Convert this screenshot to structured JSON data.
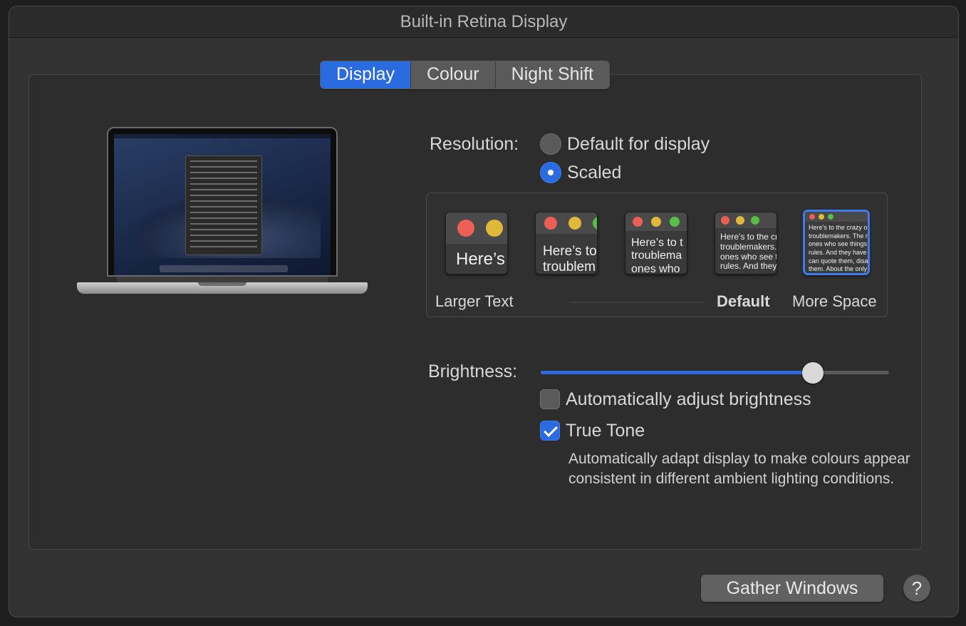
{
  "window": {
    "title": "Built-in Retina Display"
  },
  "tabs": [
    {
      "label": "Display",
      "active": true
    },
    {
      "label": "Colour",
      "active": false
    },
    {
      "label": "Night Shift",
      "active": false
    }
  ],
  "resolution": {
    "label": "Resolution:",
    "options": [
      {
        "label": "Default for display",
        "selected": false
      },
      {
        "label": "Scaled",
        "selected": true
      }
    ],
    "scale_labels": {
      "left": "Larger Text",
      "default": "Default",
      "right": "More Space"
    },
    "previews": [
      {
        "text": "Here’s",
        "selected": false
      },
      {
        "text": "Here’s to\ntroublem",
        "selected": false
      },
      {
        "text": "Here’s to t\ntroublema\nones who",
        "selected": false
      },
      {
        "text": "Here’s to the cr\ntroublemakers.\nones who see t\nrules. And they",
        "selected": false
      },
      {
        "text": "Here’s to the crazy ones\ntroublemakers. The rou\nones who see things dif\nrules. And they have no\ncan quote them, disagre\nthem. About the only th\nBecause they change th",
        "selected": true
      }
    ]
  },
  "brightness": {
    "label": "Brightness:",
    "level": 0.8,
    "auto_adjust": {
      "label": "Automatically adjust brightness",
      "checked": false
    },
    "true_tone": {
      "label": "True Tone",
      "checked": true,
      "description": "Automatically adapt display to make colours appear consistent in different ambient lighting conditions."
    }
  },
  "footer": {
    "gather_label": "Gather Windows",
    "help_label": "?"
  },
  "colors": {
    "accent": "#2b6be0",
    "traffic_red": "#ec5f56",
    "traffic_yellow": "#e0b93a",
    "traffic_green": "#57be47"
  }
}
